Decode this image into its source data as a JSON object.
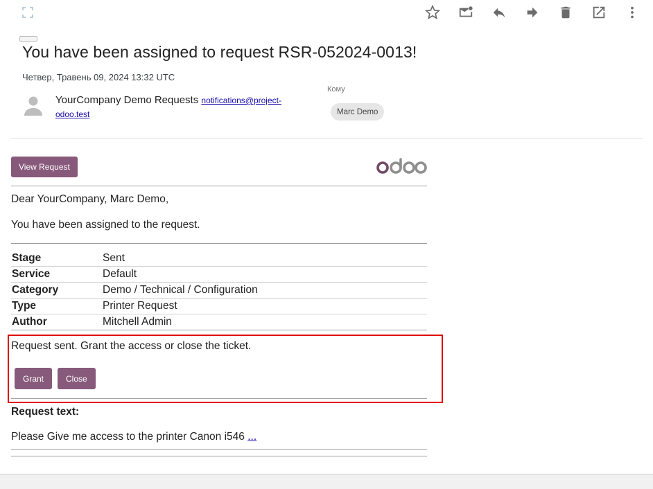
{
  "toolbar": {
    "icons": [
      "expand-icon",
      "star-icon",
      "mark-unread-icon",
      "reply-icon",
      "forward-icon",
      "delete-icon",
      "open-external-icon",
      "more-vert-icon"
    ]
  },
  "message": {
    "subject": "You have been assigned to request RSR-052024-0013!",
    "date": "Четвер, Травень 09, 2024 13:32 UTC",
    "sender_name": "YourCompany Demo Requests",
    "sender_email": "notifications@project-odoo.test",
    "to_label": "Кому",
    "to_recipient": "Marc Demo"
  },
  "body": {
    "view_button": "View Request",
    "logo_text": "odoo",
    "greeting": "Dear YourCompany, Marc Demo,",
    "assigned_text": "You have been assigned to the request.",
    "details": [
      {
        "key": "Stage",
        "value": "Sent"
      },
      {
        "key": "Service",
        "value": "Default"
      },
      {
        "key": "Category",
        "value": "Demo / Technical / Configuration"
      },
      {
        "key": "Type",
        "value": "Printer Request"
      },
      {
        "key": "Author",
        "value": "Mitchell Admin"
      }
    ],
    "action_text": "Request sent. Grant the access or close the ticket.",
    "grant_button": "Grant",
    "close_button": "Close",
    "request_text_label": "Request text:",
    "request_text": "Please Give me access to the printer Canon i546",
    "more_link": "..."
  },
  "colors": {
    "odoo_purple": "#875a7b",
    "highlight_red": "#e00000",
    "link_blue": "#1a0dab"
  }
}
